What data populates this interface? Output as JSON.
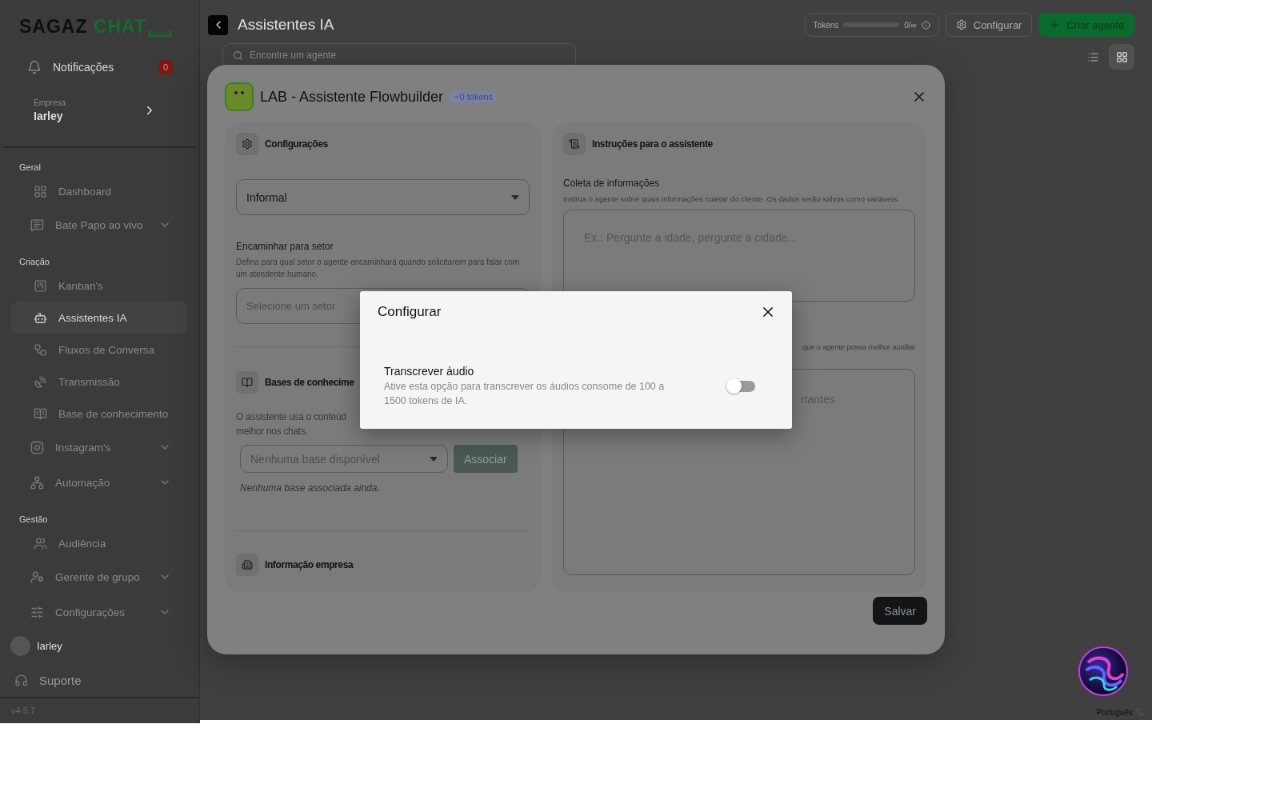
{
  "sidebar": {
    "logo": [
      "SAGAZ",
      "CHAT"
    ],
    "notifications": {
      "label": "Notificações",
      "count": "0"
    },
    "company": {
      "caption": "Empresa",
      "name": "Iarley"
    },
    "groups": [
      {
        "title": "Geral",
        "items": [
          {
            "label": "Dashboard",
            "expandable": false,
            "selected": false
          },
          {
            "label": "Bate Papo ao vivo",
            "expandable": true,
            "selected": false
          }
        ]
      },
      {
        "title": "Criação",
        "items": [
          {
            "label": "Kanban's",
            "expandable": false,
            "selected": false
          },
          {
            "label": "Assistentes IA",
            "expandable": false,
            "selected": true
          },
          {
            "label": "Fluxos de Conversa",
            "expandable": false,
            "selected": false
          },
          {
            "label": "Transmissão",
            "expandable": false,
            "selected": false
          },
          {
            "label": "Base de conhecimento",
            "expandable": false,
            "selected": false
          },
          {
            "label": "Instagram's",
            "expandable": true,
            "selected": false
          },
          {
            "label": "Automação",
            "expandable": true,
            "selected": false
          }
        ]
      },
      {
        "title": "Gestão",
        "items": [
          {
            "label": "Audiência",
            "expandable": false,
            "selected": false
          },
          {
            "label": "Gerente de grupo",
            "expandable": true,
            "selected": false
          },
          {
            "label": "Configurações",
            "expandable": true,
            "selected": false
          }
        ]
      }
    ],
    "user": {
      "name": "Iarley"
    },
    "support": "Suporte",
    "version": "v4.5.7"
  },
  "header": {
    "title": "Assistentes IA",
    "tokens": {
      "label": "Tokens",
      "level": 0,
      "reading": "0/∞"
    },
    "buttons": [
      {
        "label": "Configurar",
        "kind": "secondary"
      },
      {
        "label": "Criar agente",
        "kind": "primary"
      }
    ],
    "search": {
      "placeholder": "Encontre um agente"
    },
    "views": [
      {
        "kind": "list",
        "selected": false
      },
      {
        "kind": "grid",
        "selected": true
      }
    ]
  },
  "agent_modal": {
    "title": "LAB - Assistente Flowbuilder",
    "badge": "~0 tokens",
    "left_panel": {
      "title": "Configurações",
      "tone": "Informal",
      "sector": {
        "label": "Encaminhar para setor",
        "description": "Defina para qual setor o agente encaminhará quando solicitarem para falar com um atendente humano.",
        "placeholder": "Selecione um setor"
      },
      "knowledge": {
        "title": "Bases de conhecime",
        "lines": [
          "O assistente usa o conteúd",
          "melhor nos chats."
        ],
        "placeholder": "Nenhuma base disponível",
        "button": "Associar",
        "empty": "Nenhuma base associada ainda."
      },
      "company_title": "Informação empresa"
    },
    "right_panel": {
      "title": "Instruções para o assistente",
      "collect": {
        "label": "Coleta de informações",
        "description": "Instrua o agente sobre quais informações coletar do cliente. Os dados serão salvos como variáveis.",
        "placeholder": "Ex.: Pergunte a idade, pergunte a cidade..."
      },
      "second": {
        "description": "que o agente possa melhor auxiliar",
        "placeholder": "rtantes"
      }
    },
    "save_button": "Salvar"
  },
  "config_dialog": {
    "title": "Configurar",
    "options": [
      {
        "label": "Transcrever áudio",
        "description": "Ative esta opção para transcrever os áudios consome de 100 a 1500 tokens de IA.",
        "on": false
      }
    ]
  },
  "language": "Português"
}
